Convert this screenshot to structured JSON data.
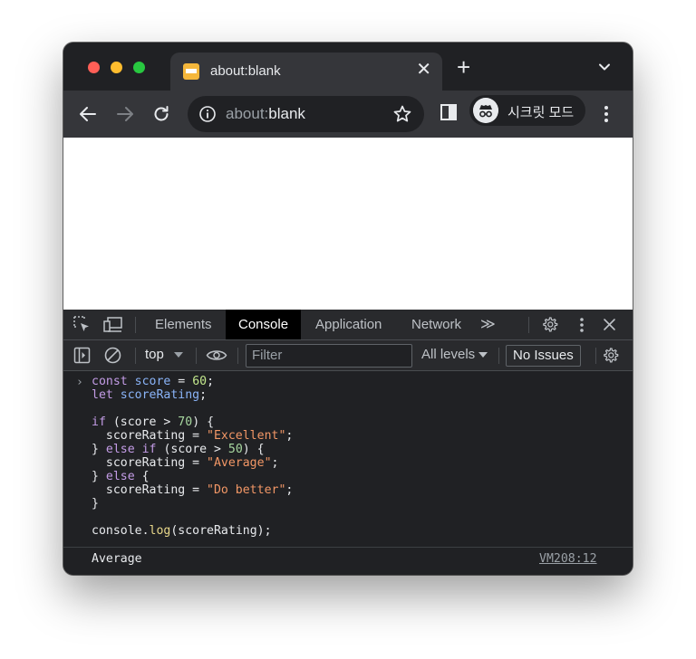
{
  "tab": {
    "title": "about:blank",
    "close": "✕",
    "new_tab": "+"
  },
  "omnibox": {
    "scheme": "about:",
    "host": "blank"
  },
  "profile": {
    "label": "시크릿 모드"
  },
  "devtools": {
    "tabs": [
      "Elements",
      "Console",
      "Application",
      "Network",
      "≫"
    ],
    "active_tab": "Console",
    "context": "top",
    "filter_placeholder": "Filter",
    "levels": "All levels",
    "issues": "No Issues"
  },
  "console": {
    "prompt": "›",
    "output": "Average",
    "source": "VM208:12"
  },
  "colors": {
    "tl_red": "#ff5f57",
    "tl_yellow": "#febc2e",
    "tl_green": "#28c840",
    "accent_favicon": "#f5b73b"
  }
}
